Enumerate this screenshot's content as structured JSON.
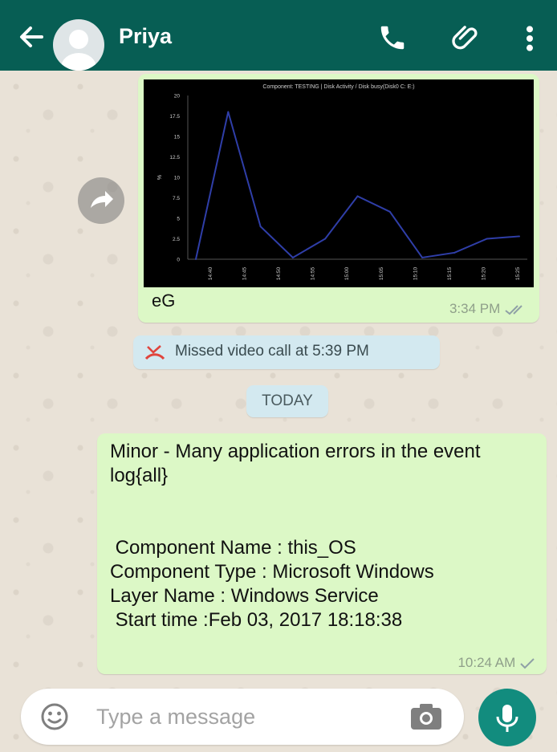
{
  "header": {
    "contact_name": "Priya"
  },
  "image_message": {
    "caption": "eG",
    "time": "3:34 PM",
    "status": "read"
  },
  "chart_data": {
    "type": "line",
    "title": "Component: TESTING | Disk Activity / Disk busy(Disk0 C: E:)",
    "ylabel": "%",
    "x": [
      "14:40",
      "14:45",
      "14:50",
      "14:55",
      "15:00",
      "15:05",
      "15:10",
      "15:15",
      "15:20",
      "15:25"
    ],
    "series": [
      {
        "values": [
          0,
          18,
          4,
          0.2,
          2.5,
          7.7,
          5.8,
          0.2,
          0.8,
          2.5,
          2.8
        ]
      }
    ],
    "ylim": [
      0,
      20
    ],
    "yticks": [
      0,
      2.5,
      5,
      7.5,
      10,
      12.5,
      15,
      17.5,
      20
    ],
    "colors": {
      "line": "#2f3ea8",
      "background": "#000000",
      "text": "#cfcfcf"
    }
  },
  "missed_call": {
    "text": "Missed video call at 5:39 PM"
  },
  "date_divider": {
    "label": "TODAY"
  },
  "text_message": {
    "body": "Minor - Many application errors in the event log{all}\n\n\n Component Name : this_OS\nComponent Type : Microsoft Windows\nLayer Name : Windows Service\n Start time :Feb 03, 2017 18:18:38",
    "time": "10:24 AM",
    "status": "sent"
  },
  "input": {
    "placeholder": "Type a message"
  },
  "colors": {
    "header": "#075e54",
    "bubble_out": "#dcf8c6",
    "accent": "#128c7e",
    "system_bubble": "#d3e9f0"
  }
}
